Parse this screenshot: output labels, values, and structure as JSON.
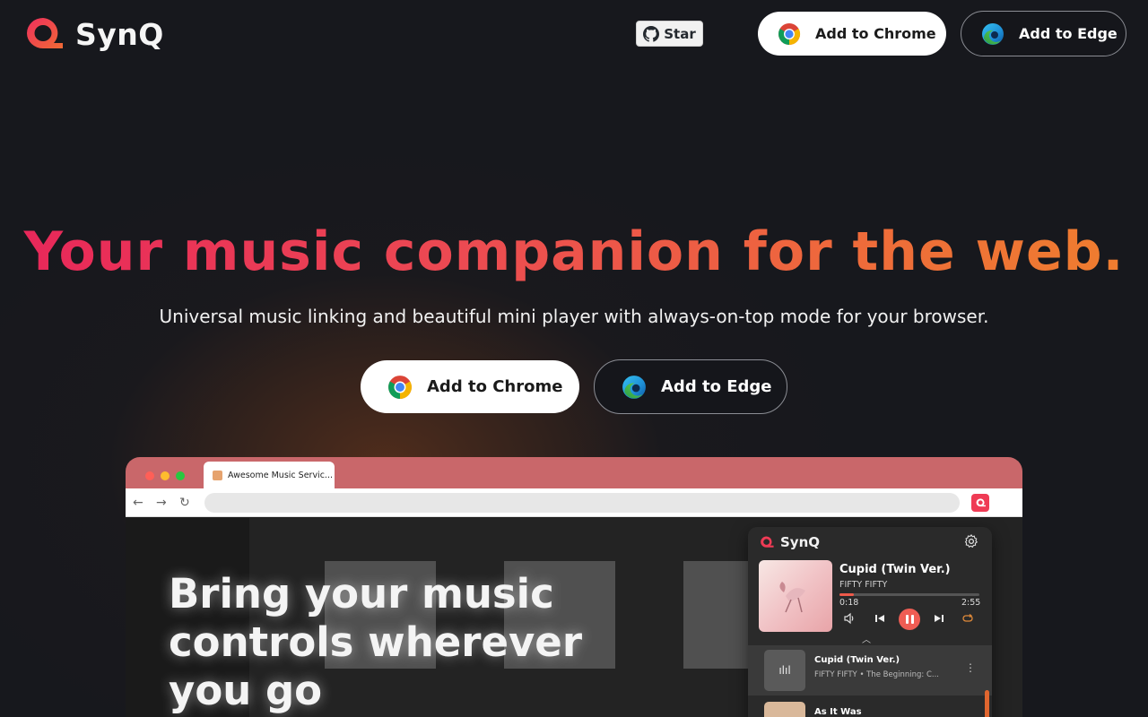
{
  "brand": {
    "name": "SynQ"
  },
  "nav": {
    "github_star": "Star",
    "chrome_button": "Add to Chrome",
    "edge_button": "Add to Edge"
  },
  "hero": {
    "title": "Your music companion for the web.",
    "subtitle": "Universal music linking and beautiful mini player with always-on-top mode for your browser.",
    "chrome_button": "Add to Chrome",
    "edge_button": "Add to Edge"
  },
  "mockup": {
    "tab_title": "Awesome Music Servic...",
    "page_heading": "Bring your music controls wherever you go",
    "player": {
      "brand": "SynQ",
      "track_title": "Cupid (Twin Ver.)",
      "artist": "FIFTY FIFTY",
      "time_current": "0:18",
      "time_total": "2:55",
      "progress_fraction": 0.1
    },
    "queue": [
      {
        "title": "Cupid (Twin Ver.)",
        "subtitle": "FIFTY FIFTY • The Beginning: C..."
      },
      {
        "title": "As It Was",
        "subtitle": ""
      }
    ]
  },
  "colors": {
    "background": "#17181d",
    "accent_red": "#e8265a",
    "accent_orange": "#ef7f2e",
    "tabbar": "#c9676a"
  },
  "icons": [
    "synq-logo-icon",
    "github-icon",
    "chrome-icon",
    "edge-icon",
    "back-icon",
    "forward-icon",
    "reload-icon",
    "gear-icon",
    "volume-icon",
    "previous-icon",
    "pause-icon",
    "next-icon",
    "repeat-icon",
    "chevron-up-icon",
    "more-icon"
  ]
}
